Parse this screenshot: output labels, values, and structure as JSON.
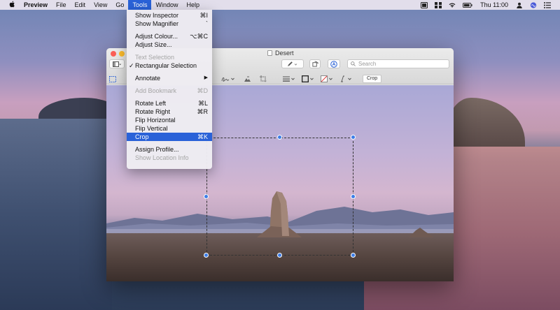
{
  "menubar": {
    "app_name": "Preview",
    "items": [
      "File",
      "Edit",
      "View",
      "Go",
      "Tools",
      "Window",
      "Help"
    ],
    "active_item": "Tools",
    "clock": "Thu 11:00"
  },
  "window": {
    "title": "Desert",
    "search_placeholder": "Search",
    "crop_label": "Crop"
  },
  "tools_menu": {
    "items": [
      {
        "label": "Show Inspector",
        "shortcut": "⌘I"
      },
      {
        "label": "Show Magnifier",
        "shortcut": "`"
      },
      {
        "label": "Adjust Colour...",
        "shortcut": "⌥⌘C"
      },
      {
        "label": "Adjust Size..."
      },
      {
        "label": "Text Selection"
      },
      {
        "label": "Rectangular Selection"
      },
      {
        "label": "Annotate",
        "shortcut": "▶"
      },
      {
        "label": "Add Bookmark",
        "shortcut": "⌘D"
      },
      {
        "label": "Rotate Left",
        "shortcut": "⌘L"
      },
      {
        "label": "Rotate Right",
        "shortcut": "⌘R"
      },
      {
        "label": "Flip Horizontal"
      },
      {
        "label": "Flip Vertical"
      },
      {
        "label": "Crop",
        "shortcut": "⌘K"
      },
      {
        "label": "Assign Profile..."
      },
      {
        "label": "Show Location Info"
      }
    ],
    "checkmark": "✓"
  },
  "colors": {
    "accent": "#2a62d8",
    "handle": "#3d7ee8"
  }
}
